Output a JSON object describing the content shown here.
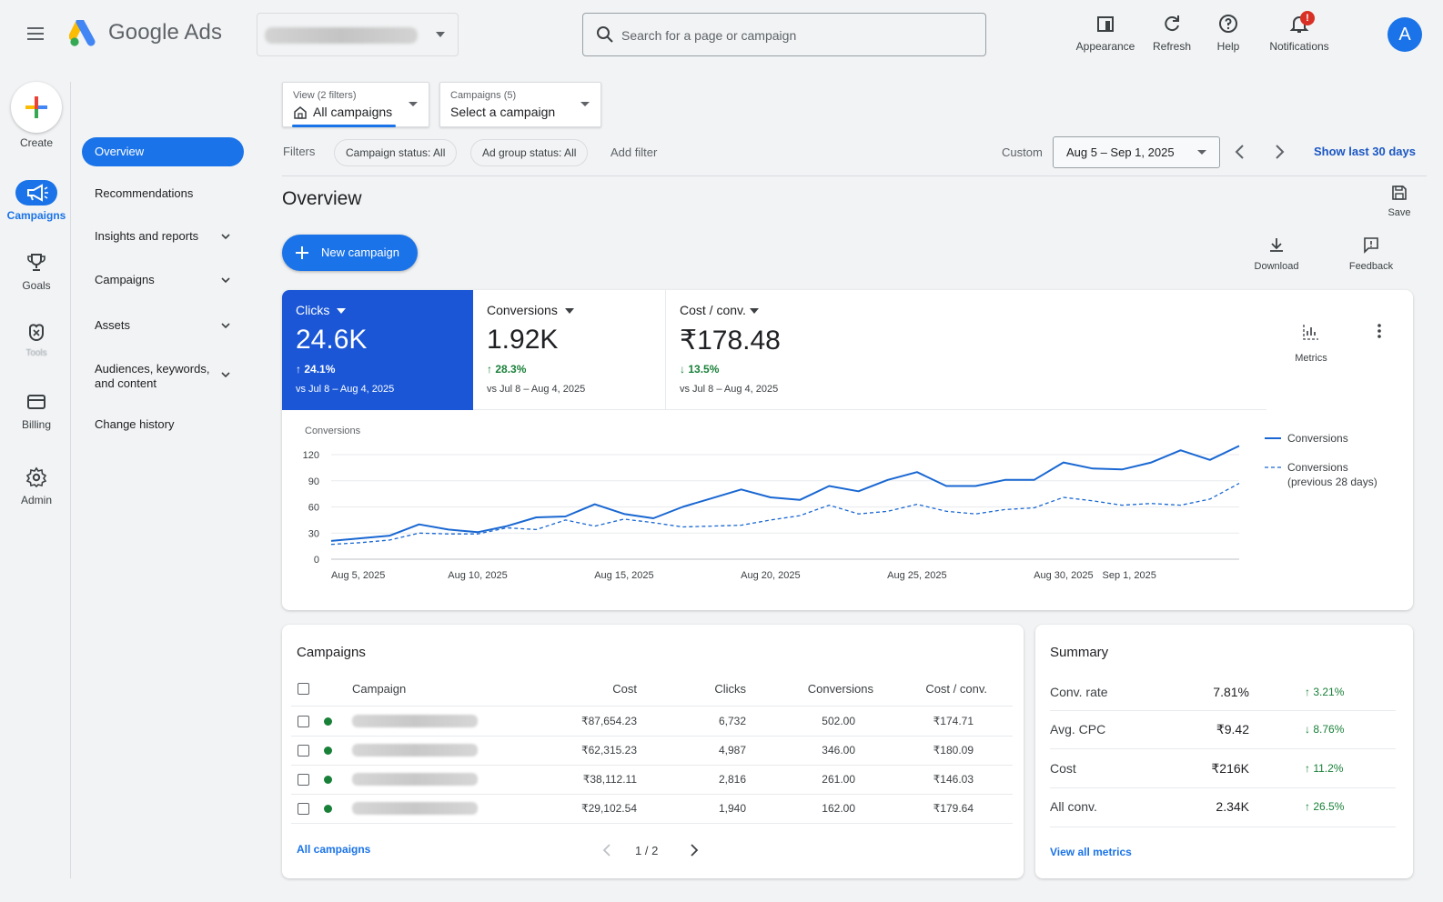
{
  "header": {
    "brand": "Google Ads",
    "search_placeholder": "Search for a page or campaign",
    "actions": [
      {
        "label": "Appearance",
        "icon": "appearance-icon"
      },
      {
        "label": "Refresh",
        "icon": "refresh-icon"
      },
      {
        "label": "Help",
        "icon": "help-icon"
      },
      {
        "label": "Notifications",
        "icon": "bell-icon"
      }
    ],
    "notification_badge": "!",
    "avatar_initial": "A"
  },
  "rail": {
    "create_label": "Create",
    "items": [
      {
        "label": "Campaigns",
        "icon": "megaphone-icon",
        "active": true
      },
      {
        "label": "Goals",
        "icon": "trophy-icon",
        "active": false
      },
      {
        "label": "Tools",
        "icon": "tools-icon",
        "active": false
      },
      {
        "label": "Billing",
        "icon": "card-icon",
        "active": false
      },
      {
        "label": "Admin",
        "icon": "gear-icon",
        "active": false
      }
    ]
  },
  "nav": {
    "active": "Overview",
    "items": [
      "Recommendations",
      "Insights and reports",
      "Campaigns",
      "Assets",
      "Audiences, keywords, and content",
      "Change history"
    ]
  },
  "filters": {
    "view_label": "View (2 filters)",
    "view_value": "All campaigns",
    "campaigns_label": "Campaigns (5)",
    "campaigns_value": "Select a campaign",
    "filters_label": "Filters",
    "chips": [
      "Campaign status: All",
      "Ad group status: All"
    ],
    "add_filter": "Add filter",
    "range_type": "Custom",
    "date_range": "Aug 5 – Sep 1, 2025",
    "show_last": "Show last 30 days"
  },
  "page": {
    "title": "Overview",
    "save": "Save",
    "new_campaign": "New campaign",
    "download": "Download",
    "feedback": "Feedback"
  },
  "metrics": {
    "items": [
      {
        "label": "Clicks",
        "value": "24.6K",
        "delta": "24.1%",
        "direction": "up",
        "compare": "vs Jul 8 – Aug 4, 2025"
      },
      {
        "label": "Conversions",
        "value": "1.92K",
        "delta": "28.3%",
        "direction": "up",
        "compare": "vs Jul 8 – Aug 4, 2025"
      },
      {
        "label": "Cost / conv.",
        "value": "₹178.48",
        "delta": "13.5%",
        "direction": "down",
        "compare": "vs Jul 8 – Aug 4, 2025"
      }
    ],
    "metrics_button": "Metrics"
  },
  "colors": {
    "accent": "#1a73e8",
    "chart_line": "#1967d2",
    "positive": "#188038",
    "negative": "#188038"
  },
  "chart_data": {
    "type": "line",
    "ylabel": "Conversions",
    "ylim": [
      0,
      120
    ],
    "yticks": [
      0,
      30,
      60,
      90,
      120
    ],
    "x_tick_labels": [
      "Aug 5, 2025",
      "Aug 10, 2025",
      "Aug 15, 2025",
      "Aug 20, 2025",
      "Aug 25, 2025",
      "Aug 30, 2025",
      "Sep 1, 2025"
    ],
    "x_tick_days": [
      0,
      5,
      10,
      15,
      20,
      25,
      27
    ],
    "x_days": [
      0,
      1,
      2,
      3,
      4,
      5,
      6,
      7,
      8,
      9,
      10,
      11,
      12,
      13,
      14,
      15,
      16,
      17,
      18,
      19,
      20,
      21,
      22,
      23,
      24,
      25,
      26,
      27,
      28,
      29,
      30,
      31
    ],
    "grid": true,
    "legend_position": "right",
    "series": [
      {
        "name": "Conversions",
        "style": "solid",
        "values": [
          21,
          24,
          27,
          40,
          34,
          31,
          38,
          48,
          49,
          63,
          52,
          47,
          60,
          70,
          80,
          71,
          68,
          84,
          78,
          91,
          100,
          84,
          84,
          91,
          91,
          111,
          104,
          103,
          111,
          125,
          114,
          130
        ]
      },
      {
        "name": "Conversions (previous 28 days)",
        "style": "dashed",
        "values": [
          17,
          19,
          22,
          30,
          29,
          29,
          36,
          34,
          45,
          38,
          46,
          42,
          37,
          38,
          39,
          45,
          50,
          62,
          52,
          55,
          63,
          55,
          52,
          57,
          59,
          71,
          67,
          62,
          64,
          62,
          69,
          87
        ]
      }
    ]
  },
  "campaigns": {
    "title": "Campaigns",
    "columns": [
      "Campaign",
      "Cost",
      "Clicks",
      "Conversions",
      "Cost / conv."
    ],
    "rows": [
      {
        "cost": "₹87,654.23",
        "clicks": "6,732",
        "conversions": "502.00",
        "cpa": "₹174.71"
      },
      {
        "cost": "₹62,315.23",
        "clicks": "4,987",
        "conversions": "346.00",
        "cpa": "₹180.09"
      },
      {
        "cost": "₹38,112.11",
        "clicks": "2,816",
        "conversions": "261.00",
        "cpa": "₹146.03"
      },
      {
        "cost": "₹29,102.54",
        "clicks": "1,940",
        "conversions": "162.00",
        "cpa": "₹179.64"
      }
    ],
    "all_link": "All campaigns",
    "pagination": "1 / 2"
  },
  "summary": {
    "title": "Summary",
    "rows": [
      {
        "label": "Conv. rate",
        "value": "7.81%",
        "delta": "3.21%",
        "direction": "up"
      },
      {
        "label": "Avg. CPC",
        "value": "₹9.42",
        "delta": "8.76%",
        "direction": "down"
      },
      {
        "label": "Cost",
        "value": "₹216K",
        "delta": "11.2%",
        "direction": "up"
      },
      {
        "label": "All conv.",
        "value": "2.34K",
        "delta": "26.5%",
        "direction": "up"
      }
    ],
    "view_all": "View all metrics"
  }
}
